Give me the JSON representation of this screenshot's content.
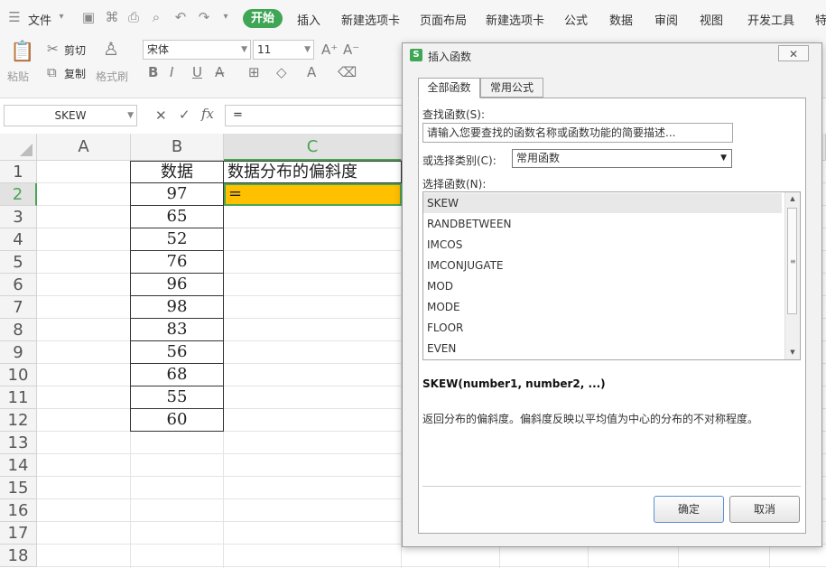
{
  "menu": {
    "file": "文件",
    "tabs": [
      "开始",
      "插入",
      "新建选项卡",
      "页面布局",
      "新建选项卡",
      "公式",
      "数据",
      "审阅",
      "视图",
      "开发工具",
      "特"
    ]
  },
  "ribbon": {
    "paste": "粘贴",
    "cut": "剪切",
    "copy": "复制",
    "format_painter": "格式刷",
    "font_name": "宋体",
    "font_size": "11"
  },
  "formula_bar": {
    "name_box": "SKEW",
    "fx": "fx",
    "value": "="
  },
  "sheet": {
    "columns": [
      "A",
      "B",
      "C"
    ],
    "rows": [
      "1",
      "2",
      "3",
      "4",
      "5",
      "6",
      "7",
      "8",
      "9",
      "10",
      "11",
      "12",
      "13",
      "14",
      "15",
      "16",
      "17",
      "18"
    ],
    "b_header": "数据",
    "c_header": "数据分布的偏斜度",
    "b_values": [
      "97",
      "65",
      "52",
      "76",
      "96",
      "98",
      "83",
      "56",
      "68",
      "55",
      "60"
    ],
    "c2_value": "=",
    "selection_color": "#ffc000"
  },
  "dialog": {
    "logo": "S",
    "title": "插入函数",
    "close": "✕",
    "tab_all": "全部函数",
    "tab_common": "常用公式",
    "search_label": "查找函数(S):",
    "search_value": "请输入您要查找的函数名称或函数功能的简要描述...",
    "category_label": "或选择类别(C):",
    "category_value": "常用函数",
    "list_label": "选择函数(N):",
    "functions": [
      "SKEW",
      "RANDBETWEEN",
      "IMCOS",
      "IMCONJUGATE",
      "MOD",
      "MODE",
      "FLOOR",
      "EVEN"
    ],
    "signature": "SKEW(number1, number2, ...)",
    "description": "返回分布的偏斜度。偏斜度反映以平均值为中心的分布的不对称程度。",
    "ok": "确定",
    "cancel": "取消"
  },
  "colors": {
    "accent_green": "#3fa655",
    "selection": "#ffc000"
  }
}
